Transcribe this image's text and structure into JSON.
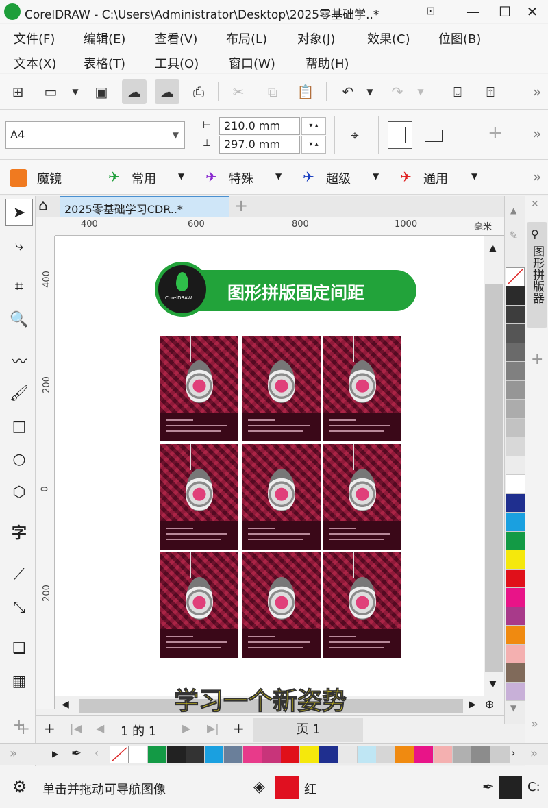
{
  "window": {
    "title": "CorelDRAW - C:\\Users\\Administrator\\Desktop\\2025零基础学..*",
    "minimize": "—",
    "maximize": "☐",
    "close": "✕"
  },
  "menu": {
    "row1": [
      "文件(F)",
      "编辑(E)",
      "查看(V)",
      "布局(L)",
      "对象(J)",
      "效果(C)",
      "位图(B)"
    ],
    "row2": [
      "文本(X)",
      "表格(T)",
      "工具(O)",
      "窗口(W)",
      "帮助(H)"
    ]
  },
  "property_bar": {
    "page_size": "A4",
    "width": "210.0 mm",
    "height": "297.0 mm"
  },
  "effects_bar": {
    "magic": "魔镜",
    "items": [
      "常用",
      "特殊",
      "超级",
      "通用"
    ]
  },
  "document": {
    "tab_label": "2025零基础学习CDR..*",
    "unit": "毫米",
    "ruler_top": [
      "400",
      "600",
      "800",
      "1000"
    ],
    "ruler_left": [
      "400",
      "200",
      "0",
      "200"
    ],
    "banner_text": "图形拼版固定间距",
    "logo_text": "CorelDRAW",
    "caption": "学习一个新姿势"
  },
  "docker": {
    "label": "图形拼版器"
  },
  "page_nav": {
    "page_of": "1 的 1",
    "page_tab": "页 1"
  },
  "status": {
    "hint": "单击并拖动可导航图像",
    "fill_name": "红",
    "outline_label": "C:"
  },
  "colors": {
    "accent_green": "#22a33a",
    "fill_red": "#e01020",
    "vertical_palette": [
      "#2b2b2b",
      "#3d3d3d",
      "#555555",
      "#6a6a6a",
      "#808080",
      "#969696",
      "#acacac",
      "#c2c2c2",
      "#d8d8d8",
      "#ececec",
      "#ffffff",
      "#1f2f8f",
      "#1aa0e0",
      "#139a45",
      "#f5e80c",
      "#e0101a",
      "#e81488",
      "#a83a8a",
      "#f08a10",
      "#f4b0b0",
      "#806a5a",
      "#c8b0d8"
    ],
    "horizontal_palette": [
      "#ffffff",
      "#139a45",
      "#222222",
      "#333333",
      "#1aa0e0",
      "#6a7f9a",
      "#e83a8a",
      "#c8347a",
      "#e0101a",
      "#f5e80c",
      "#1f2f8f",
      "#e8e8e8",
      "#bfe6f4",
      "#d6d6d6",
      "#f08a10",
      "#e81488",
      "#f4b0b0",
      "#b0b0b0",
      "#8c8c8c",
      "#cccccc"
    ]
  }
}
